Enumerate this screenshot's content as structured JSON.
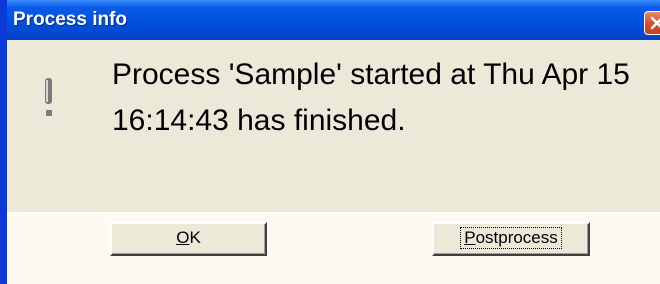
{
  "window": {
    "title": "Process info"
  },
  "dialog": {
    "icon": "info-exclamation-icon",
    "message": "Process 'Sample' started at Thu Apr 15 16:14:43 has finished."
  },
  "buttons": {
    "ok_label": "OK",
    "postprocess_label": "Postprocess"
  },
  "colors": {
    "titlebar": "#0052de",
    "close_button": "#d9552f",
    "dialog_background": "#ece9d8",
    "button_strip": "#fcfaf1"
  }
}
